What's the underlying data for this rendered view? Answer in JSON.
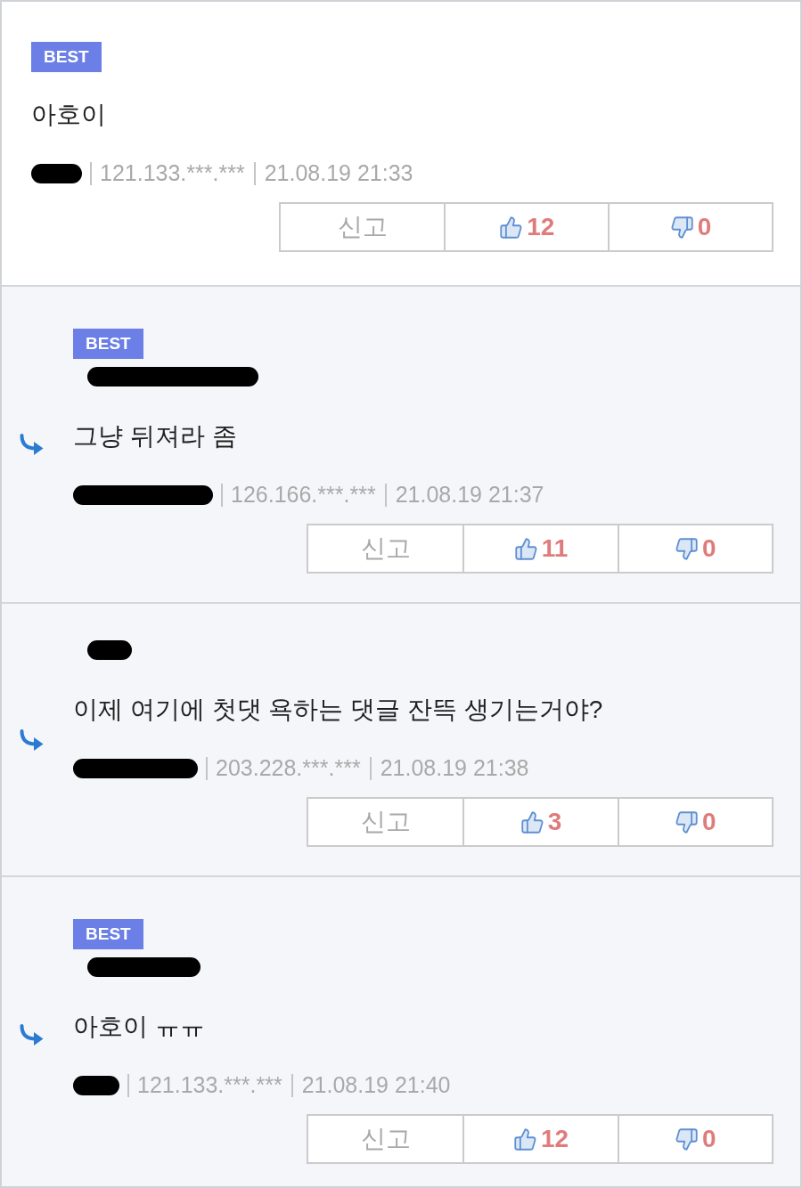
{
  "comments": [
    {
      "kind": "comment",
      "badge": "BEST",
      "text": "아호이",
      "ip": "121.133.***.***",
      "date": "21.08.19 21:33",
      "report": "신고",
      "likes": "12",
      "dislikes": "0"
    },
    {
      "kind": "reply",
      "badge": "BEST",
      "text": "그냥 뒤져라 좀",
      "ip": "126.166.***.***",
      "date": "21.08.19 21:37",
      "report": "신고",
      "likes": "11",
      "dislikes": "0"
    },
    {
      "kind": "reply",
      "text": "이제 여기에 첫댓 욕하는 댓글 잔뜩 생기는거야?",
      "ip": "203.228.***.***",
      "date": "21.08.19 21:38",
      "report": "신고",
      "likes": "3",
      "dislikes": "0"
    },
    {
      "kind": "reply",
      "badge": "BEST",
      "text": "아호이 ㅠㅠ",
      "ip": "121.133.***.***",
      "date": "21.08.19 21:40",
      "report": "신고",
      "likes": "12",
      "dislikes": "0"
    }
  ]
}
